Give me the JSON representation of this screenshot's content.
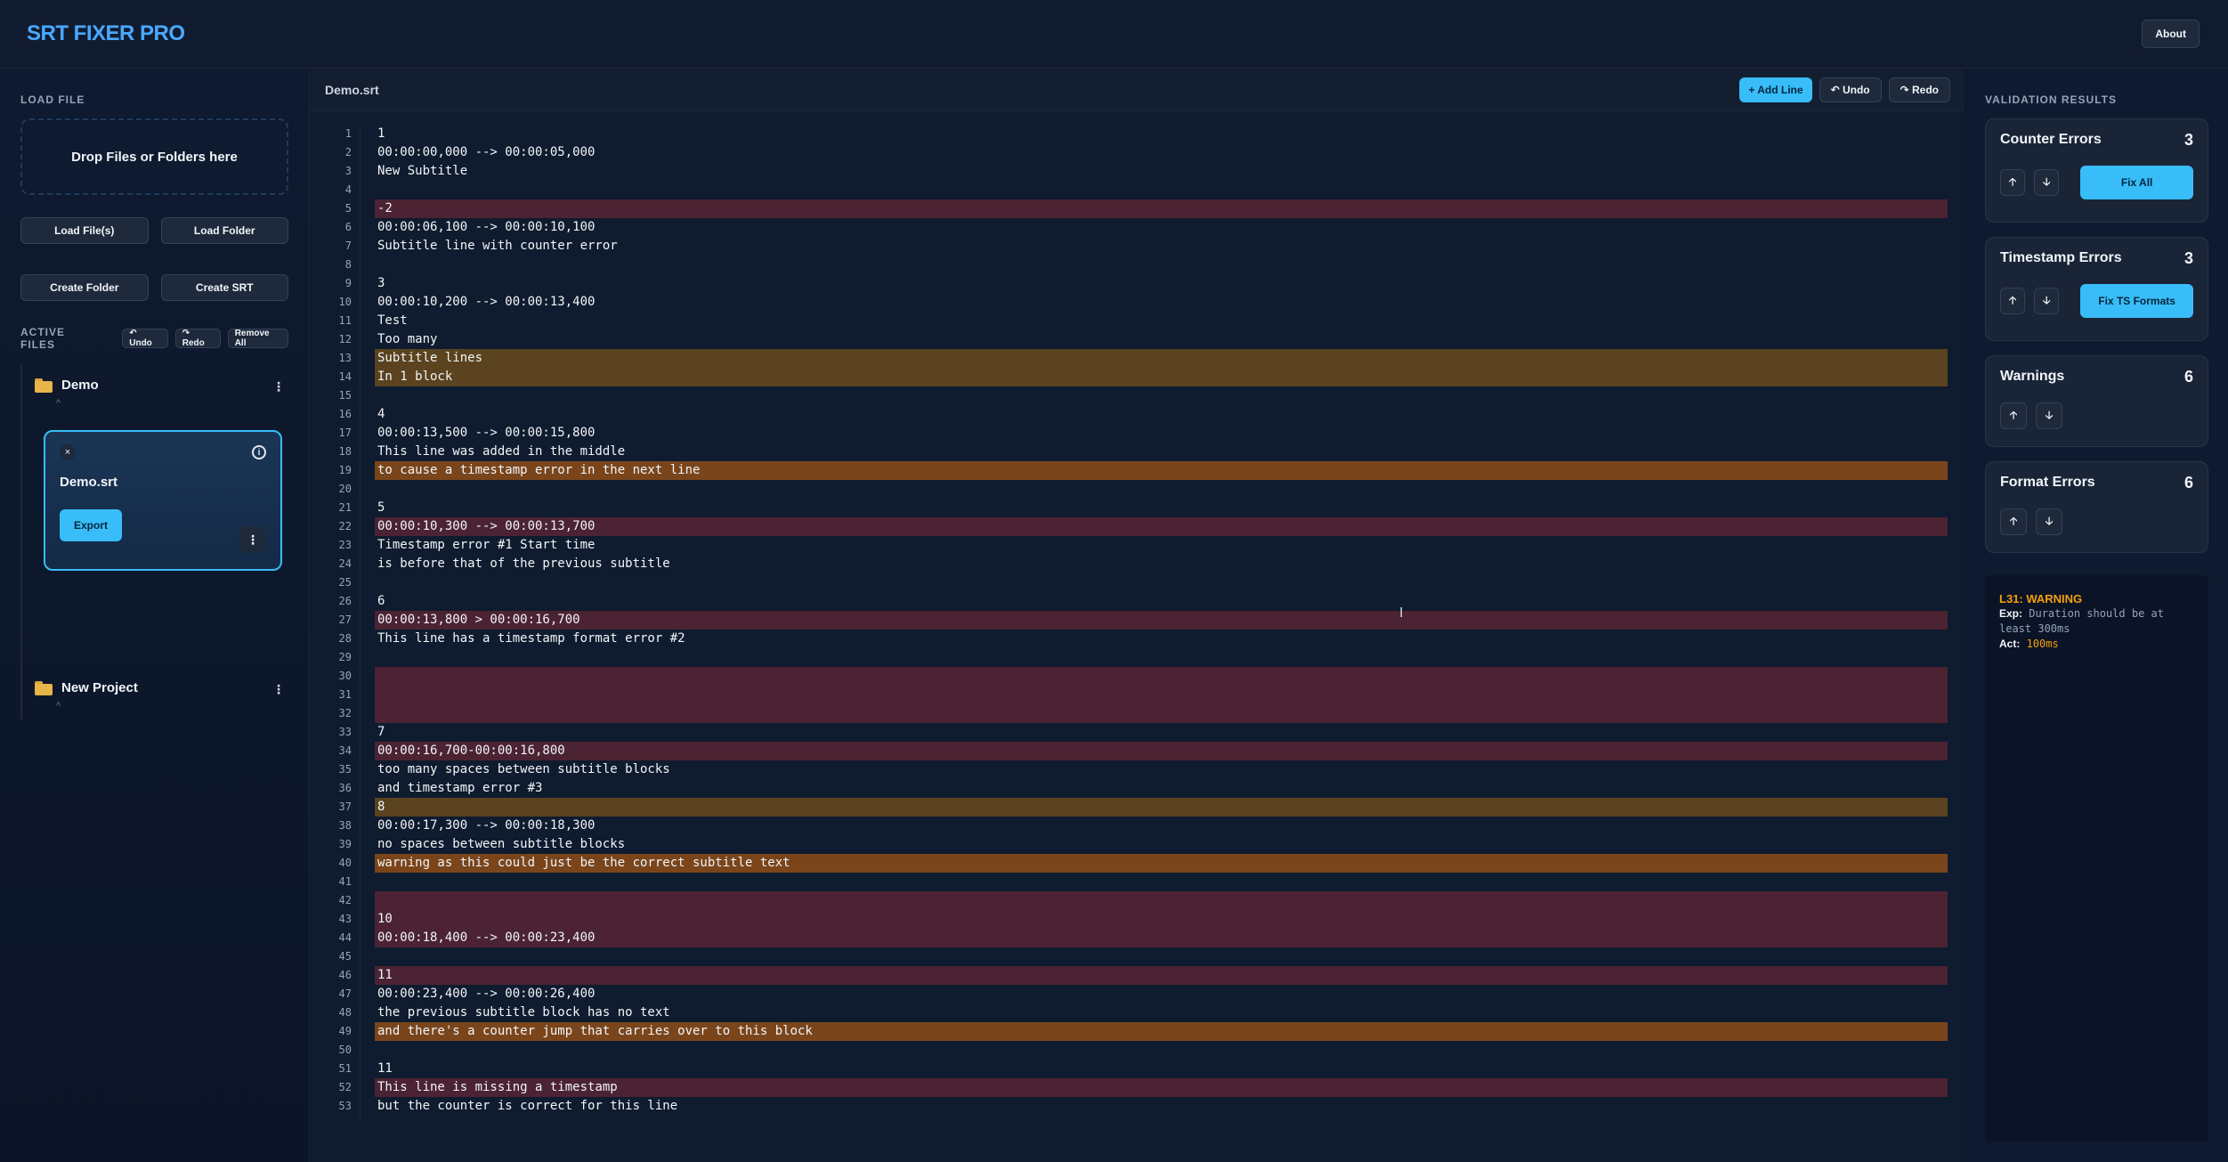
{
  "app": {
    "title": "SRT FIXER PRO",
    "about_label": "About"
  },
  "sidebar": {
    "load_file_title": "LOAD FILE",
    "drop_zone_label": "Drop Files or Folders here",
    "load_files_label": "Load File(s)",
    "load_folder_label": "Load Folder",
    "create_folder_label": "Create Folder",
    "create_srt_label": "Create SRT",
    "active_files_title": "ACTIVE FILES",
    "undo_label": "↶ Undo",
    "redo_label": "↷ Redo",
    "remove_all_label": "Remove All",
    "projects": [
      {
        "name": "Demo"
      },
      {
        "name": "New Project"
      }
    ],
    "file_card": {
      "name": "Demo.srt",
      "close_glyph": "×",
      "export_label": "Export",
      "menu_glyph": "⋮",
      "info_glyph": "i"
    },
    "kebab_glyph": "⋮",
    "caret_glyph": "^"
  },
  "editor": {
    "filename": "Demo.srt",
    "add_line_label": "+ Add Line",
    "undo_label": "↶ Undo",
    "redo_label": "↷ Redo",
    "lines": [
      "1",
      "00:00:00,000 --> 00:00:05,000",
      "New Subtitle",
      "",
      "-2",
      "00:00:06,100 --> 00:00:10,100",
      "Subtitle line with counter error",
      "",
      "3",
      "00:00:10,200 --> 00:00:13,400",
      "Test",
      "Too many",
      "Subtitle lines",
      "In 1 block",
      "",
      "4",
      "00:00:13,500 --> 00:00:15,800",
      "This line was added in the middle",
      "to cause a timestamp error in the next line",
      "",
      "5",
      "00:00:10,300 --> 00:00:13,700",
      "Timestamp error #1 Start time",
      "is before that of the previous subtitle",
      "",
      "6",
      "00:00:13,800 > 00:00:16,700",
      "This line has a timestamp format error #2",
      "",
      "",
      "",
      "",
      "7",
      "00:00:16,700-00:00:16,800",
      "too many spaces between subtitle blocks",
      "and timestamp error #3",
      "8",
      "00:00:17,300 --> 00:00:18,300",
      "no spaces between subtitle blocks",
      "warning as this could just be the correct subtitle text",
      "",
      "",
      "10",
      "00:00:18,400 --> 00:00:23,400",
      "",
      "11",
      "00:00:23,400 --> 00:00:26,400",
      "the previous subtitle block has no text",
      "and there's a counter jump that carries over to this block",
      "",
      "11",
      "This line is missing a timestamp",
      "but the counter is correct for this line"
    ],
    "error_lines": [
      5,
      22,
      27,
      30,
      31,
      32,
      34,
      42,
      43,
      44,
      46,
      52
    ],
    "warning_lines": [
      13,
      14,
      37
    ],
    "strong_warning_lines": [
      19,
      40,
      49
    ]
  },
  "validation": {
    "title": "VALIDATION RESULTS",
    "up_glyph": "🡡",
    "down_glyph": "🡣",
    "cards": [
      {
        "name": "Counter Errors",
        "count": "3",
        "fix_label": "Fix All"
      },
      {
        "name": "Timestamp Errors",
        "count": "3",
        "fix_label": "Fix TS Formats"
      },
      {
        "name": "Warnings",
        "count": "6"
      },
      {
        "name": "Format Errors",
        "count": "6"
      }
    ],
    "detail": {
      "heading": "L31: WARNING",
      "exp_key": "Exp:",
      "exp_text": "Duration should be at least 300ms",
      "act_key": "Act:",
      "act_text": "100ms"
    }
  },
  "colors": {
    "accent": "#38bdf8",
    "brand": "#4aa8ff",
    "error_bg": "#4b2332",
    "warning_bg": "#5a431e",
    "warning_strong_bg": "#7a451b"
  }
}
